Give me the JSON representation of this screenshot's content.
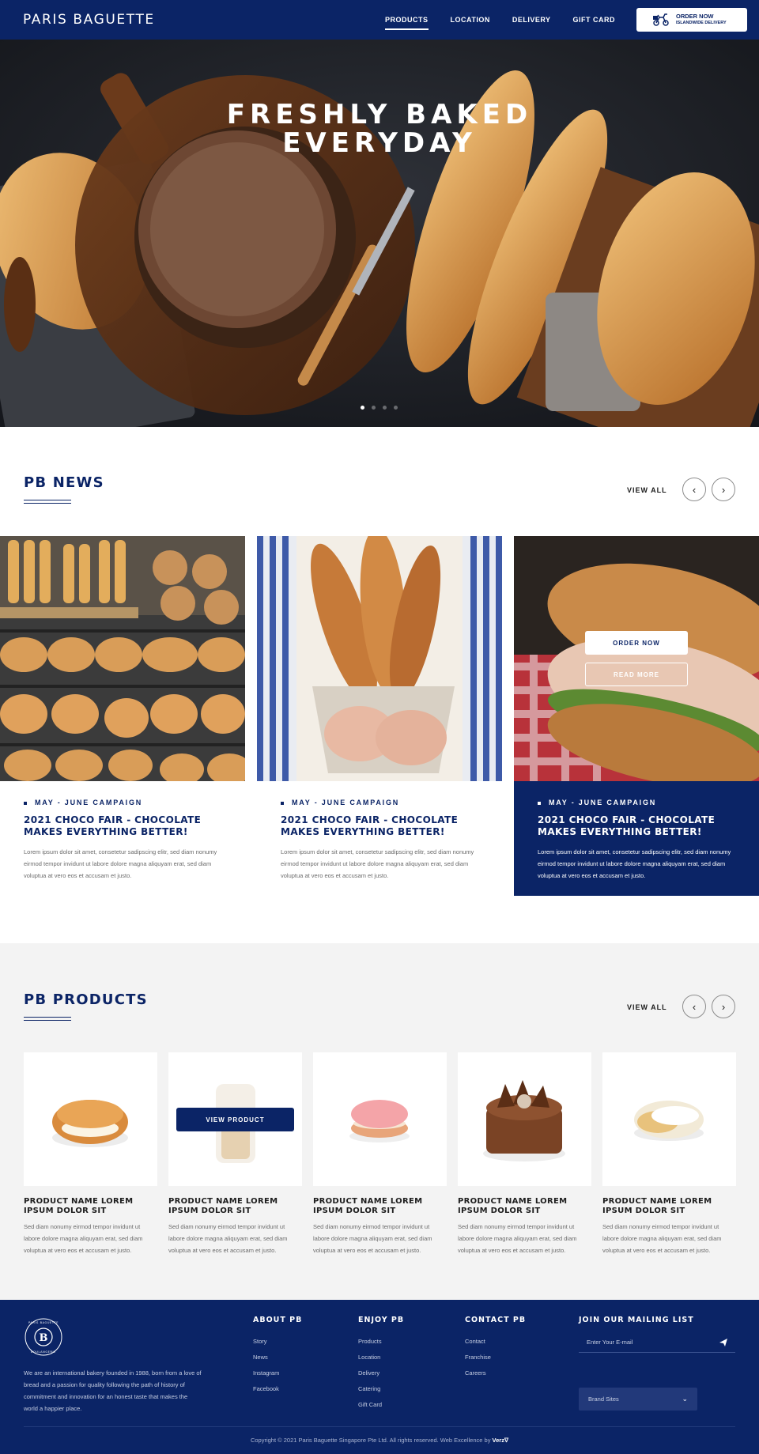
{
  "header": {
    "logo": "PARIS BAGUETTE",
    "nav": [
      "PRODUCTS",
      "LOCATION",
      "DELIVERY",
      "GIFT CARD"
    ],
    "order_now": "ORDER NOW",
    "order_sub": "ISLANDWIDE DELIVERY",
    "icon": "scooter-icon"
  },
  "hero": {
    "title_line1": "FRESHLY BAKED",
    "title_line2": "EVERYDAY",
    "slides": 4,
    "active_slide": 1
  },
  "news": {
    "title": "PB NEWS",
    "view_all": "VIEW ALL",
    "cards": [
      {
        "campaign": "MAY - JUNE CAMPAIGN",
        "title": "2021 CHOCO FAIR - CHOCOLATE MAKES EVERYTHING BETTER!",
        "desc": "Lorem ipsum dolor sit amet, consetetur sadipscing elitr, sed diam nonumy eirmod tempor invidunt ut labore dolore magna aliquyam erat, sed diam voluptua at vero eos et accusam et justo."
      },
      {
        "campaign": "MAY - JUNE CAMPAIGN",
        "title": "2021 CHOCO FAIR - CHOCOLATE MAKES EVERYTHING BETTER!",
        "desc": "Lorem ipsum dolor sit amet, consetetur sadipscing elitr, sed diam nonumy eirmod tempor invidunt ut labore dolore magna aliquyam erat, sed diam voluptua at vero eos et accusam et justo."
      },
      {
        "campaign": "MAY - JUNE CAMPAIGN",
        "title": "2021 CHOCO FAIR - CHOCOLATE MAKES EVERYTHING BETTER!",
        "desc": "Lorem ipsum dolor sit amet, consetetur sadipscing elitr, sed diam nonumy eirmod tempor invidunt ut labore dolore magna aliquyam erat, sed diam voluptua at vero eos et accusam et justo."
      }
    ],
    "order_now": "ORDER NOW",
    "read_more": "READ MORE"
  },
  "products": {
    "title": "PB PRODUCTS",
    "view_all": "VIEW ALL",
    "view_product": "VIEW PRODUCT",
    "items": [
      {
        "name": "PRODUCT NAME LOREM IPSUM DOLOR SIT",
        "desc": "Sed diam nonumy eirmod tempor invidunt ut labore dolore magna aliquyam erat, sed diam voluptua at vero eos et accusam et justo."
      },
      {
        "name": "PRODUCT NAME LOREM IPSUM DOLOR SIT",
        "desc": "Sed diam nonumy eirmod tempor invidunt ut labore dolore magna aliquyam erat, sed diam voluptua at vero eos et accusam et justo."
      },
      {
        "name": "PRODUCT NAME LOREM IPSUM DOLOR SIT",
        "desc": "Sed diam nonumy eirmod tempor invidunt ut labore dolore magna aliquyam erat, sed diam voluptua at vero eos et accusam et justo."
      },
      {
        "name": "PRODUCT NAME LOREM IPSUM DOLOR SIT",
        "desc": "Sed diam nonumy eirmod tempor invidunt ut labore dolore magna aliquyam erat, sed diam voluptua at vero eos et accusam et justo."
      },
      {
        "name": "PRODUCT NAME LOREM IPSUM DOLOR SIT",
        "desc": "Sed diam nonumy eirmod tempor invidunt ut labore dolore magna aliquyam erat, sed diam voluptua at vero eos et accusam et justo."
      }
    ]
  },
  "footer": {
    "logo_ring_text": "PARIS BAGUETTE · BOULANGERIE",
    "about": "We are an international bakery founded in 1988, born from a love of bread and a passion for quality following the path of history of commitment and innovation for an honest taste that makes the world a happier place.",
    "columns": [
      {
        "title": "ABOUT PB",
        "links": [
          "Story",
          "News",
          "Instagram",
          "Facebook"
        ]
      },
      {
        "title": "ENJOY PB",
        "links": [
          "Products",
          "Location",
          "Delivery",
          "Catering",
          "Gift Card"
        ]
      },
      {
        "title": "CONTACT PB",
        "links": [
          "Contact",
          "Franchise",
          "Careers"
        ]
      }
    ],
    "mailing_title": "JOIN OUR MAILING LIST",
    "email_placeholder": "Enter Your E-mail",
    "brand_sites": "Brand Sites",
    "copyright": "Copyright © 2021 Paris Baguette Singapore Pte Ltd. All rights reserved. Web Excellence by",
    "credit": "Verz"
  },
  "colors": {
    "brand_navy": "#0b2466",
    "footer_field": "#22397a",
    "products_bg": "#f3f3f3"
  }
}
